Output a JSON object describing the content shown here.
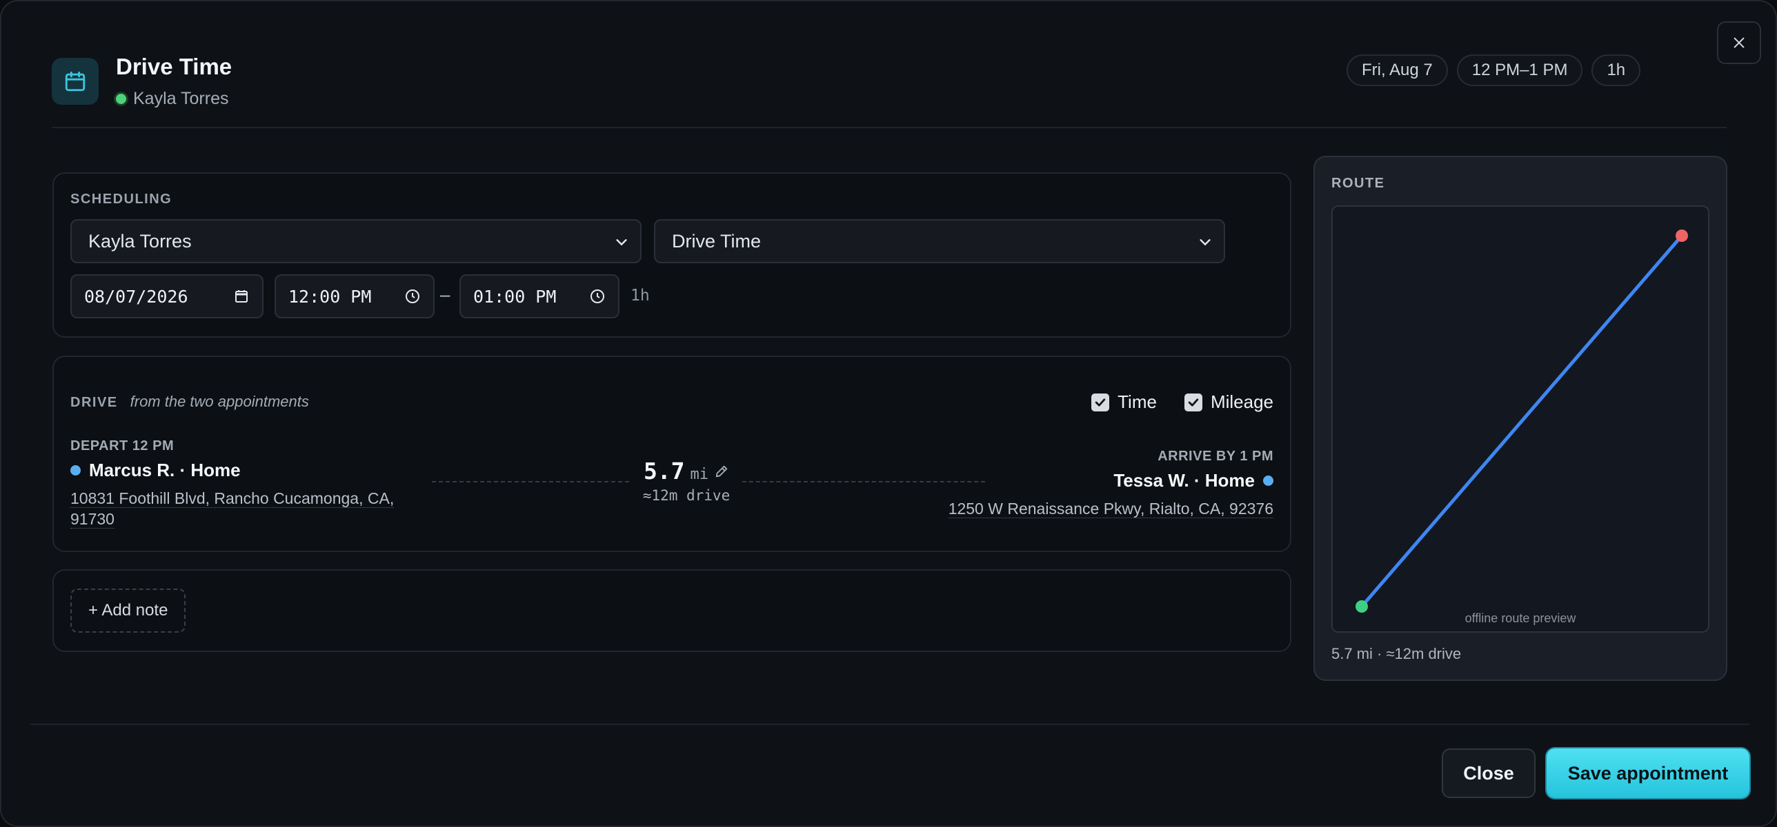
{
  "header": {
    "title": "Drive Time",
    "staff": "Kayla Torres",
    "chips": [
      "Fri, Aug 7",
      "12 PM–1 PM",
      "1h"
    ]
  },
  "scheduling": {
    "label": "SCHEDULING",
    "staff_select": "Kayla Torres",
    "type_select": "Drive Time",
    "date": "08/07/2026",
    "start": "12:00 PM",
    "end": "01:00 PM",
    "separator": "–",
    "duration": "1h"
  },
  "drive": {
    "label": "DRIVE",
    "sub": "from the two appointments",
    "check_time": "Time",
    "check_mileage": "Mileage",
    "depart_label": "DEPART 12 PM",
    "depart_place": "Marcus R. · Home",
    "depart_addr_1": "10831 Foothill Blvd, Rancho Cucamonga, CA,",
    "depart_addr_2": "91730",
    "distance": "5.7",
    "unit": "mi",
    "drive_time": "≈12m drive",
    "arrive_label": "ARRIVE BY 1 PM",
    "arrive_place": "Tessa W. · Home",
    "arrive_addr": "1250 W Renaissance Pkwy, Rialto, CA, 92376"
  },
  "note": {
    "add_label": "+ Add note"
  },
  "route": {
    "label": "ROUTE",
    "caption": "offline route preview",
    "summary": "5.7 mi · ≈12m drive"
  },
  "footer": {
    "close_label": "Close",
    "save_label": "Save appointment"
  },
  "colors": {
    "accent": "#2ecbe0",
    "route_line": "#3f86f0",
    "start_marker": "#3ecf83",
    "end_marker": "#f06464",
    "location_dot": "#5aaef0",
    "online_dot": "#4cd37a"
  }
}
